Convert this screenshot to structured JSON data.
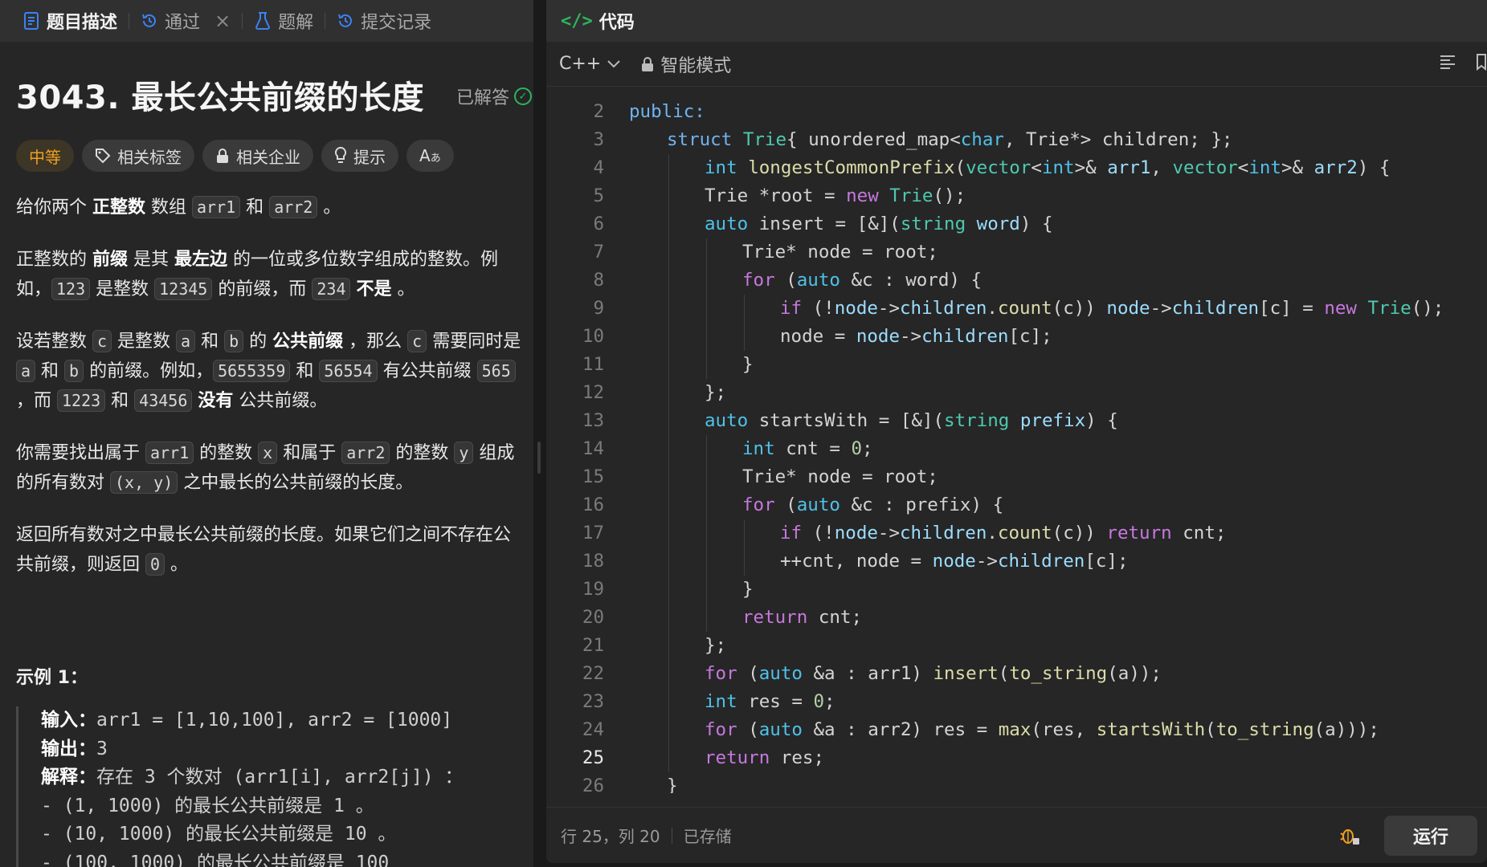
{
  "left_tabs": [
    {
      "label": "题目描述",
      "icon": "document-icon",
      "active": true
    },
    {
      "label": "通过",
      "icon": "history-icon",
      "active": false
    },
    {
      "label": "题解",
      "icon": "flask-icon",
      "active": false
    },
    {
      "label": "提交记录",
      "icon": "history-icon",
      "active": false
    }
  ],
  "problem": {
    "title": "3043. 最长公共前缀的长度",
    "solved_label": "已解答",
    "difficulty": "中等",
    "chips": [
      "相关标签",
      "相关企业",
      "提示",
      "Aあ"
    ]
  },
  "description": {
    "p1": [
      "给你两个 ",
      "正整数",
      " 数组 ",
      "arr1",
      " 和 ",
      "arr2",
      " 。"
    ],
    "p2": [
      "正整数的 ",
      "前缀",
      " 是其 ",
      "最左边",
      " 的一位或多位数字组成的整数。例如，",
      "123",
      " 是整数 ",
      "12345",
      " 的前缀，而 ",
      "234",
      " ",
      "不是",
      " 。"
    ],
    "p3": [
      "设若整数 ",
      "c",
      " 是整数 ",
      "a",
      " 和 ",
      "b",
      " 的 ",
      "公共前缀",
      " ，那么 ",
      "c",
      " 需要同时是 ",
      "a",
      " 和 ",
      "b",
      " 的前缀。例如，",
      "5655359",
      " 和 ",
      "56554",
      " 有公共前缀 ",
      "565",
      " ，而 ",
      "1223",
      " 和 ",
      "43456",
      " ",
      "没有",
      " 公共前缀。"
    ],
    "p4": [
      "你需要找出属于 ",
      "arr1",
      " 的整数 ",
      "x",
      " 和属于 ",
      "arr2",
      " 的整数 ",
      "y",
      " 组成的所有数对 ",
      "(x, y)",
      " 之中最长的公共前缀的长度。"
    ],
    "p5": [
      "返回所有数对之中最长公共前缀的长度。如果它们之间不存在公共前缀，则返回 ",
      "0",
      " 。"
    ]
  },
  "example": {
    "title": "示例 1：",
    "input_label": "输入：",
    "input_value": "arr1 = [1,10,100], arr2 = [1000]",
    "output_label": "输出：",
    "output_value": "3",
    "explain_label": "解释：",
    "explain_value": "存在 3 个数对 (arr1[i], arr2[j]) ：",
    "bullets": [
      "- (1, 1000) 的最长公共前缀是 1 。",
      "- (10, 1000) 的最长公共前缀是 10 。",
      "- (100, 1000) 的最长公共前缀是 100"
    ]
  },
  "code_panel": {
    "header": "代码",
    "language": "C++",
    "mode": "智能模式",
    "status_position": "行 25，列 20",
    "status_saved": "已存储",
    "run_label": "运行",
    "current_line": 25,
    "lines": [
      {
        "n": 2,
        "indent": 0,
        "tokens": [
          [
            "a",
            "public:"
          ]
        ]
      },
      {
        "n": 3,
        "indent": 1,
        "tokens": [
          [
            "a",
            "struct "
          ],
          [
            "c",
            "Trie"
          ],
          [
            "",
            "{ unordered_map<"
          ],
          [
            "t",
            "char"
          ],
          [
            "",
            ", Trie*> children; };"
          ]
        ]
      },
      {
        "n": 4,
        "indent": 2,
        "tokens": [
          [
            "t",
            "int "
          ],
          [
            "f",
            "longestCommonPrefix"
          ],
          [
            "",
            "("
          ],
          [
            "c",
            "vector"
          ],
          [
            "",
            "<"
          ],
          [
            "t",
            "int"
          ],
          [
            "",
            ">& "
          ],
          [
            "v",
            "arr1"
          ],
          [
            "",
            ", "
          ],
          [
            "c",
            "vector"
          ],
          [
            "",
            "<"
          ],
          [
            "t",
            "int"
          ],
          [
            "",
            ">& "
          ],
          [
            "v",
            "arr2"
          ],
          [
            "",
            ") {"
          ]
        ]
      },
      {
        "n": 5,
        "indent": 2,
        "tokens": [
          [
            "",
            "Trie *root = "
          ],
          [
            "k",
            "new "
          ],
          [
            "c",
            "Trie"
          ],
          [
            "",
            "();"
          ]
        ]
      },
      {
        "n": 6,
        "indent": 2,
        "tokens": [
          [
            "t",
            "auto "
          ],
          [
            "",
            "insert = [&]("
          ],
          [
            "c",
            "string "
          ],
          [
            "v",
            "word"
          ],
          [
            "",
            ") {"
          ]
        ]
      },
      {
        "n": 7,
        "indent": 3,
        "tokens": [
          [
            "",
            "Trie* node = root;"
          ]
        ]
      },
      {
        "n": 8,
        "indent": 3,
        "tokens": [
          [
            "k",
            "for "
          ],
          [
            "",
            "("
          ],
          [
            "t",
            "auto "
          ],
          [
            "",
            "&c : word) {"
          ]
        ]
      },
      {
        "n": 9,
        "indent": 4,
        "tokens": [
          [
            "k",
            "if "
          ],
          [
            "",
            "(!"
          ],
          [
            "v",
            "node"
          ],
          [
            "",
            "->"
          ],
          [
            "v",
            "children"
          ],
          [
            "",
            "."
          ],
          [
            "f",
            "count"
          ],
          [
            "",
            "(c)) "
          ],
          [
            "v",
            "node"
          ],
          [
            "",
            "->"
          ],
          [
            "v",
            "children"
          ],
          [
            "",
            "[c] = "
          ],
          [
            "k",
            "new "
          ],
          [
            "c",
            "Trie"
          ],
          [
            "",
            "();"
          ]
        ]
      },
      {
        "n": 10,
        "indent": 4,
        "tokens": [
          [
            "",
            "node = "
          ],
          [
            "v",
            "node"
          ],
          [
            "",
            "->"
          ],
          [
            "v",
            "children"
          ],
          [
            "",
            "[c];"
          ]
        ]
      },
      {
        "n": 11,
        "indent": 3,
        "tokens": [
          [
            "",
            "}"
          ]
        ]
      },
      {
        "n": 12,
        "indent": 2,
        "tokens": [
          [
            "",
            "};"
          ]
        ]
      },
      {
        "n": 13,
        "indent": 2,
        "tokens": [
          [
            "t",
            "auto "
          ],
          [
            "",
            "startsWith = [&]("
          ],
          [
            "c",
            "string "
          ],
          [
            "v",
            "prefix"
          ],
          [
            "",
            ") {"
          ]
        ]
      },
      {
        "n": 14,
        "indent": 3,
        "tokens": [
          [
            "t",
            "int "
          ],
          [
            "",
            "cnt = "
          ],
          [
            "n",
            "0"
          ],
          [
            "",
            ";"
          ]
        ]
      },
      {
        "n": 15,
        "indent": 3,
        "tokens": [
          [
            "",
            "Trie* node = root;"
          ]
        ]
      },
      {
        "n": 16,
        "indent": 3,
        "tokens": [
          [
            "k",
            "for "
          ],
          [
            "",
            "("
          ],
          [
            "t",
            "auto "
          ],
          [
            "",
            "&c : prefix) {"
          ]
        ]
      },
      {
        "n": 17,
        "indent": 4,
        "tokens": [
          [
            "k",
            "if "
          ],
          [
            "",
            "(!"
          ],
          [
            "v",
            "node"
          ],
          [
            "",
            "->"
          ],
          [
            "v",
            "children"
          ],
          [
            "",
            "."
          ],
          [
            "f",
            "count"
          ],
          [
            "",
            "(c)) "
          ],
          [
            "k",
            "return "
          ],
          [
            "",
            "cnt;"
          ]
        ]
      },
      {
        "n": 18,
        "indent": 4,
        "tokens": [
          [
            "",
            "++cnt, node = "
          ],
          [
            "v",
            "node"
          ],
          [
            "",
            "->"
          ],
          [
            "v",
            "children"
          ],
          [
            "",
            "[c];"
          ]
        ]
      },
      {
        "n": 19,
        "indent": 3,
        "tokens": [
          [
            "",
            "}"
          ]
        ]
      },
      {
        "n": 20,
        "indent": 3,
        "tokens": [
          [
            "k",
            "return "
          ],
          [
            "",
            "cnt;"
          ]
        ]
      },
      {
        "n": 21,
        "indent": 2,
        "tokens": [
          [
            "",
            "};"
          ]
        ]
      },
      {
        "n": 22,
        "indent": 2,
        "tokens": [
          [
            "k",
            "for "
          ],
          [
            "",
            "("
          ],
          [
            "t",
            "auto "
          ],
          [
            "",
            "&a : arr1) "
          ],
          [
            "f",
            "insert"
          ],
          [
            "",
            "("
          ],
          [
            "f",
            "to_string"
          ],
          [
            "",
            "(a));"
          ]
        ]
      },
      {
        "n": 23,
        "indent": 2,
        "tokens": [
          [
            "t",
            "int "
          ],
          [
            "",
            "res = "
          ],
          [
            "n",
            "0"
          ],
          [
            "",
            ";"
          ]
        ]
      },
      {
        "n": 24,
        "indent": 2,
        "tokens": [
          [
            "k",
            "for "
          ],
          [
            "",
            "("
          ],
          [
            "t",
            "auto "
          ],
          [
            "",
            "&a : arr2) res = "
          ],
          [
            "f",
            "max"
          ],
          [
            "",
            "(res, "
          ],
          [
            "f",
            "startsWith"
          ],
          [
            "",
            "("
          ],
          [
            "f",
            "to_string"
          ],
          [
            "",
            "(a)));"
          ]
        ]
      },
      {
        "n": 25,
        "indent": 2,
        "tokens": [
          [
            "k",
            "return "
          ],
          [
            "",
            "res;"
          ]
        ]
      },
      {
        "n": 26,
        "indent": 1,
        "tokens": [
          [
            "",
            "}"
          ]
        ]
      }
    ]
  }
}
